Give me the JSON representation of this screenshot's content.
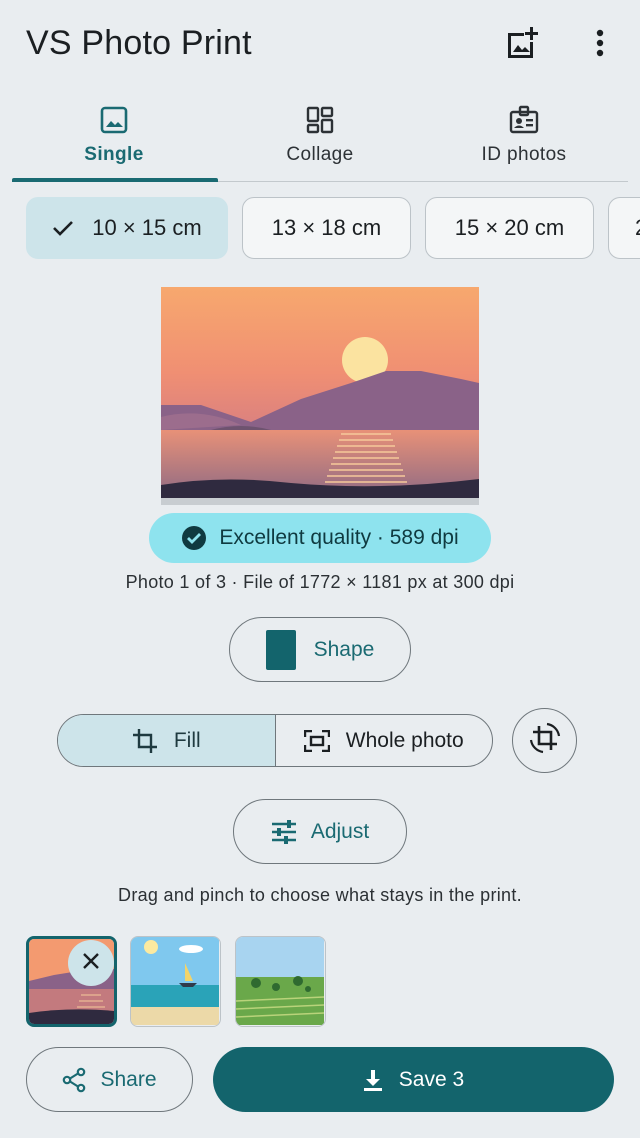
{
  "app": {
    "title": "VS Photo Print",
    "icons": {
      "add_photo": "add-photo-icon",
      "more": "more-vert-icon"
    }
  },
  "tabs": [
    {
      "label": "Single",
      "icon": "image-icon",
      "active": true
    },
    {
      "label": "Collage",
      "icon": "collage-grid-icon",
      "active": false
    },
    {
      "label": "ID photos",
      "icon": "id-badge-icon",
      "active": false
    }
  ],
  "sizes": [
    {
      "label": "10 × 15 cm",
      "selected": true
    },
    {
      "label": "13 × 18 cm",
      "selected": false
    },
    {
      "label": "15 × 20 cm",
      "selected": false
    },
    {
      "label": "2",
      "selected": false
    }
  ],
  "preview": {
    "quality_label": "Excellent quality · 589 dpi",
    "info": "Photo 1 of 3 · File of 1772 × 1181 px at 300 dpi"
  },
  "shape": {
    "label": "Shape",
    "swatch_color": "#13646c"
  },
  "mode": {
    "fill_label": "Fill",
    "whole_label": "Whole photo",
    "selected": "Fill",
    "rotate_icon": "rotate-crop-icon"
  },
  "adjust": {
    "label": "Adjust"
  },
  "hint": "Drag and pinch to choose what stays in the print.",
  "thumbnails": [
    {
      "name": "sunset-lake",
      "selected": true
    },
    {
      "name": "beach-sailboat",
      "selected": false
    },
    {
      "name": "green-field",
      "selected": false
    }
  ],
  "actions": {
    "share_label": "Share",
    "save_label": "Save 3"
  },
  "colors": {
    "accent": "#13646c",
    "accent_text": "#1a6a72",
    "selected_container": "#cde4ea",
    "quality_bg": "#8ee3ee",
    "background": "#e9edf0"
  }
}
